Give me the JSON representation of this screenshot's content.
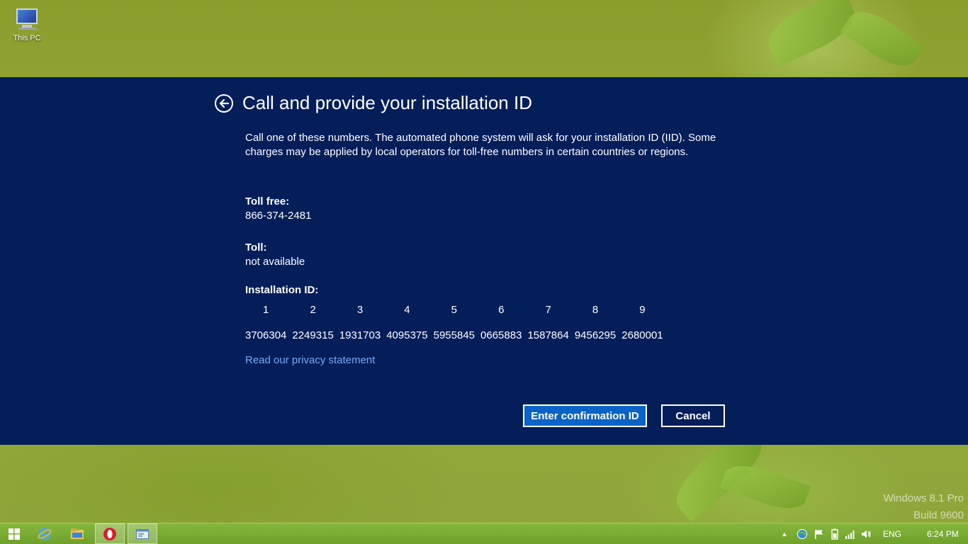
{
  "desktop": {
    "icon_label": "This PC"
  },
  "dialog": {
    "title": "Call and provide your installation ID",
    "description": "Call one of these numbers. The automated phone system will ask for your installation ID (IID). Some charges may be applied by local operators for toll-free numbers in certain countries or regions.",
    "toll_free_label": "Toll free:",
    "toll_free_value": "866-374-2481",
    "toll_label": "Toll:",
    "toll_value": "not available",
    "iid_label": "Installation ID:",
    "iid_columns": [
      "1",
      "2",
      "3",
      "4",
      "5",
      "6",
      "7",
      "8",
      "9"
    ],
    "iid_values": [
      "3706304",
      "2249315",
      "1931703",
      "4095375",
      "5955845",
      "0665883",
      "1587864",
      "9456295",
      "2680001"
    ],
    "privacy_link": "Read our privacy statement",
    "confirm_button": "Enter confirmation ID",
    "cancel_button": "Cancel"
  },
  "watermark": {
    "line1": "Windows 8.1 Pro",
    "line2": "Build 9600"
  },
  "taskbar": {
    "language": "ENG",
    "time": "6:24 PM"
  },
  "colors": {
    "dialog_bg": "#041e5a",
    "primary_button": "#0a63c6",
    "link": "#76a9f5",
    "taskbar": "#7aab33"
  }
}
